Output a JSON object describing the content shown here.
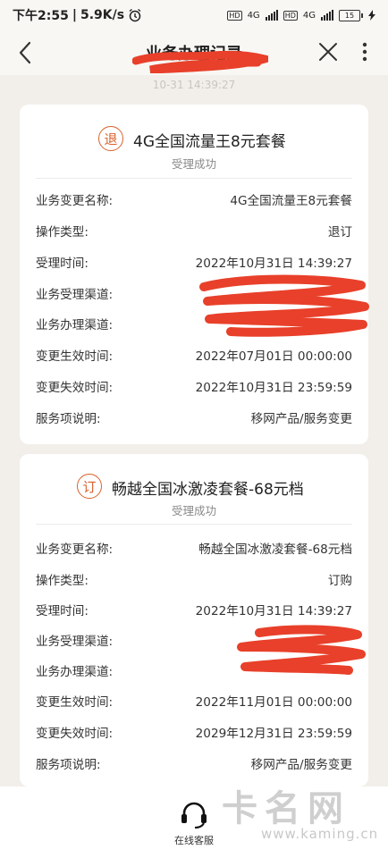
{
  "status_bar": {
    "time": "下午2:55",
    "speed": "5.9K/s",
    "net1": "4G",
    "net2": "4G",
    "battery": "15"
  },
  "nav": {
    "title": "业务办理记录"
  },
  "timestamp": "10-31 14:39:27",
  "records": [
    {
      "icon_char": "退",
      "title": "4G全国流量王8元套餐",
      "status": "受理成功",
      "rows": [
        {
          "label": "业务变更名称:",
          "value": "4G全国流量王8元套餐"
        },
        {
          "label": "操作类型:",
          "value": "退订"
        },
        {
          "label": "受理时间:",
          "value": "2022年10月31日 14:39:27"
        },
        {
          "label": "业务受理渠道:",
          "value": ""
        },
        {
          "label": "业务办理渠道:",
          "value": ""
        },
        {
          "label": "变更生效时间:",
          "value": "2022年07月01日 00:00:00"
        },
        {
          "label": "变更失效时间:",
          "value": "2022年10月31日 23:59:59"
        },
        {
          "label": "服务项说明:",
          "value": "移网产品/服务变更"
        }
      ]
    },
    {
      "icon_char": "订",
      "title": "畅越全国冰激凌套餐-68元档",
      "status": "受理成功",
      "rows": [
        {
          "label": "业务变更名称:",
          "value": "畅越全国冰激凌套餐-68元档"
        },
        {
          "label": "操作类型:",
          "value": "订购"
        },
        {
          "label": "受理时间:",
          "value": "2022年10月31日 14:39:27"
        },
        {
          "label": "业务受理渠道:",
          "value": ""
        },
        {
          "label": "业务办理渠道:",
          "value": ""
        },
        {
          "label": "变更生效时间:",
          "value": "2022年11月01日 00:00:00"
        },
        {
          "label": "变更失效时间:",
          "value": "2029年12月31日 23:59:59"
        },
        {
          "label": "服务项说明:",
          "value": "移网产品/服务变更"
        }
      ]
    }
  ],
  "bottom": {
    "service_label": "在线客服"
  },
  "watermark": {
    "cn": "卡名网",
    "en": "www.kaming.cn"
  },
  "colors": {
    "accent": "#d8622d",
    "redaction": "#e8402a"
  }
}
